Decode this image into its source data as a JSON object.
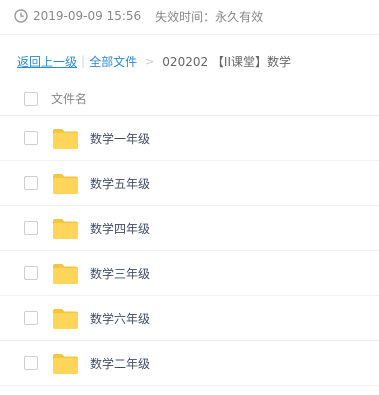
{
  "share": {
    "date": "2019-09-09 15:56",
    "expiry": "失效时间：永久有效",
    "clock_icon": "clock-icon"
  },
  "breadcrumb": {
    "back_label": "返回上一级",
    "separator": "|",
    "all_files_label": "全部文件",
    "arrow": ">",
    "current": "020202 【II课堂】数学"
  },
  "list": {
    "header_label": "文件名",
    "folder_icon": "folder-icon",
    "items": [
      {
        "name": "数学一年级"
      },
      {
        "name": "数学五年级"
      },
      {
        "name": "数学四年级"
      },
      {
        "name": "数学三年级"
      },
      {
        "name": "数学六年级"
      },
      {
        "name": "数学二年级"
      }
    ]
  },
  "colors": {
    "link": "#2c8bd6",
    "folder": "#ffd659",
    "folder_dark": "#f5c542",
    "text": "#424e67",
    "muted": "#888888"
  }
}
